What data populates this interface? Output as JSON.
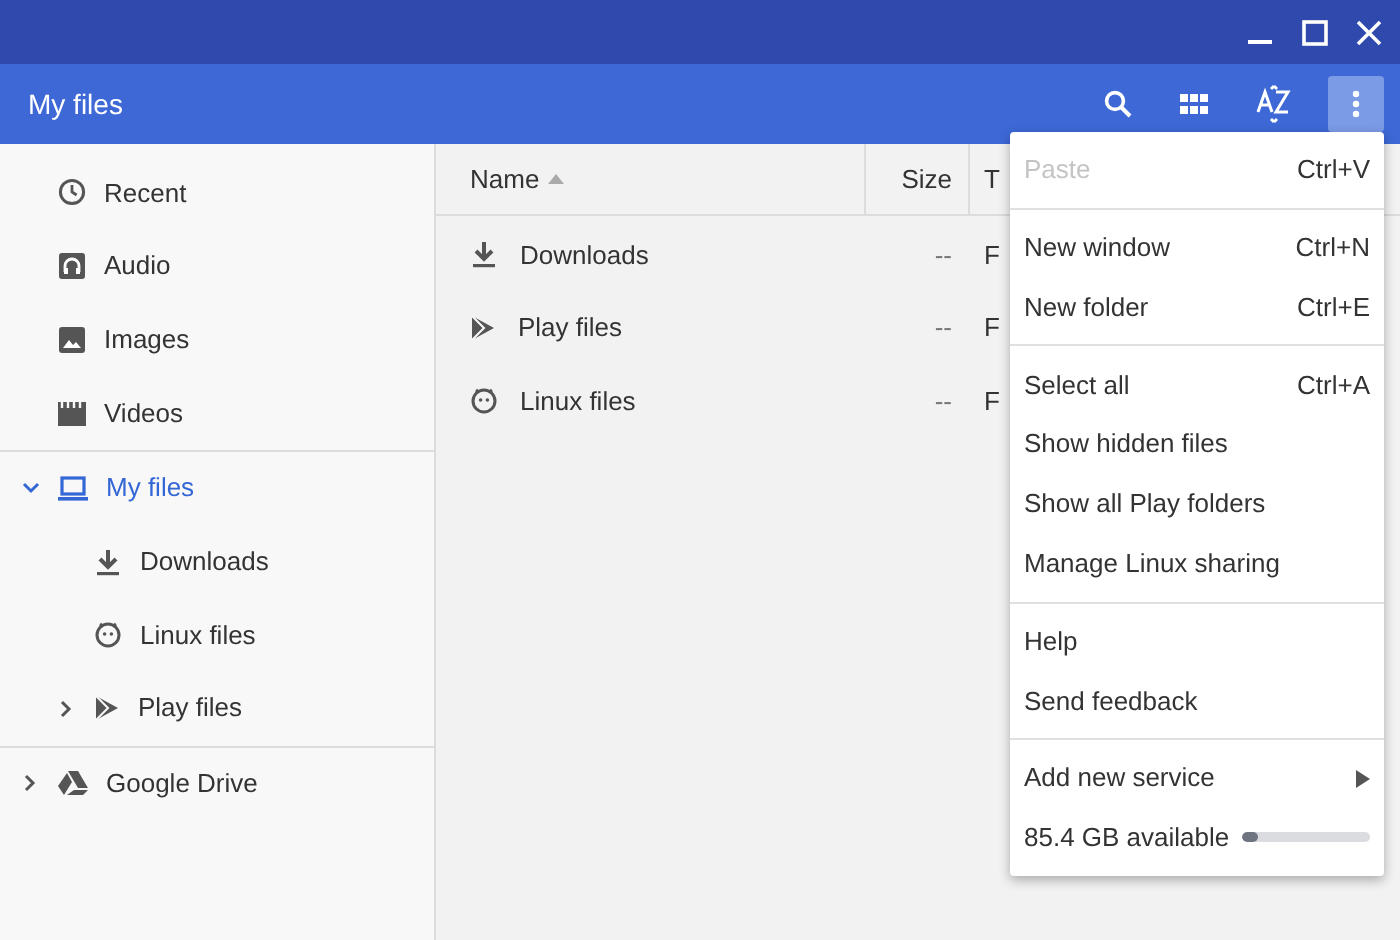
{
  "toolbar": {
    "title": "My files",
    "more_button": {
      "pressed": true
    }
  },
  "sidebar": {
    "sections": [
      [
        {
          "label": "Recent",
          "selected": false
        },
        {
          "label": "Audio",
          "selected": false
        },
        {
          "label": "Images",
          "selected": false
        },
        {
          "label": "Videos",
          "selected": false
        }
      ],
      [
        {
          "label": "My files",
          "selected": true,
          "expanded": true,
          "children": [
            {
              "label": "Downloads",
              "selected": false
            },
            {
              "label": "Linux files",
              "selected": false
            },
            {
              "label": "Play files",
              "selected": false,
              "expanded": false
            }
          ]
        }
      ],
      [
        {
          "label": "Google Drive",
          "selected": false,
          "expanded": false
        }
      ]
    ]
  },
  "table": {
    "columns": [
      {
        "label": "Name",
        "sorted": true
      },
      {
        "label": "Size",
        "sorted": false
      },
      {
        "label": "T",
        "sorted": false
      }
    ],
    "rows": [
      {
        "name": "Downloads",
        "size": "--",
        "column_3": "F"
      },
      {
        "name": "Play files",
        "size": "--",
        "column_3": "F"
      },
      {
        "name": "Linux files",
        "size": "--",
        "column_3": "F"
      }
    ]
  },
  "menu": {
    "sections": [
      [
        {
          "kind": "item",
          "label": "Paste",
          "shortcut": "Ctrl+V",
          "disabled": true
        }
      ],
      [
        {
          "kind": "item",
          "label": "New window",
          "shortcut": "Ctrl+N",
          "disabled": false
        },
        {
          "kind": "item",
          "label": "New folder",
          "shortcut": "Ctrl+E",
          "disabled": false
        }
      ],
      [
        {
          "kind": "item",
          "label": "Select all",
          "shortcut": "Ctrl+A",
          "disabled": false
        },
        {
          "kind": "item",
          "label": "Show hidden files",
          "disabled": false
        },
        {
          "kind": "item",
          "label": "Show all Play folders",
          "disabled": false
        },
        {
          "kind": "item",
          "label": "Manage Linux sharing",
          "disabled": false
        }
      ],
      [
        {
          "kind": "item",
          "label": "Help",
          "disabled": false
        },
        {
          "kind": "item",
          "label": "Send feedback",
          "disabled": false
        }
      ],
      [
        {
          "kind": "submenu",
          "label": "Add new service",
          "disabled": false
        },
        {
          "kind": "storage",
          "label": "85.4 GB available",
          "level": 0.13,
          "disabled": false
        }
      ]
    ]
  }
}
